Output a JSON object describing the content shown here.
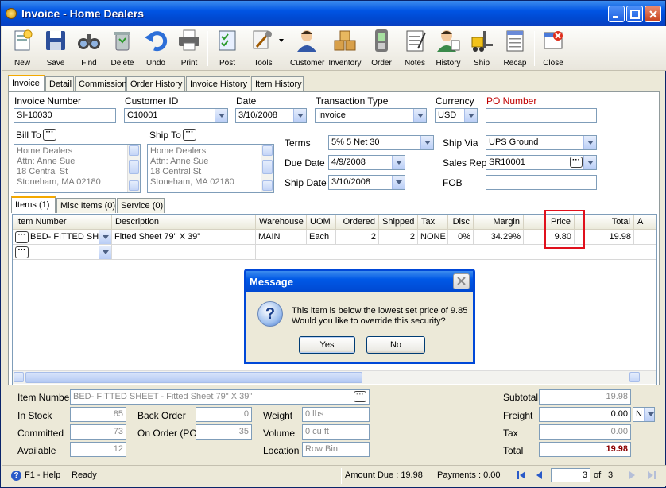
{
  "window": {
    "title": "Invoice - Home Dealers"
  },
  "toolbar": [
    {
      "label": "New",
      "icon": "new-document-icon"
    },
    {
      "label": "Save",
      "icon": "floppy-disk-icon"
    },
    {
      "label": "Find",
      "icon": "binoculars-icon"
    },
    {
      "label": "Delete",
      "icon": "trash-bin-icon"
    },
    {
      "label": "Undo",
      "icon": "undo-arrow-icon"
    },
    {
      "label": "Print",
      "icon": "printer-icon"
    },
    {
      "label": "Post",
      "icon": "post-checklist-icon"
    },
    {
      "label": "Tools",
      "icon": "tools-icon"
    },
    {
      "label": "Customer",
      "icon": "customer-person-icon"
    },
    {
      "label": "Inventory",
      "icon": "inventory-boxes-icon"
    },
    {
      "label": "Order",
      "icon": "order-device-icon"
    },
    {
      "label": "Notes",
      "icon": "notes-notepad-icon"
    },
    {
      "label": "History",
      "icon": "history-person-icon"
    },
    {
      "label": "Ship",
      "icon": "ship-forklift-icon"
    },
    {
      "label": "Recap",
      "icon": "recap-sheet-icon"
    },
    {
      "label": "Close",
      "icon": "close-window-icon"
    }
  ],
  "tabs": [
    "Invoice",
    "Detail",
    "Commission",
    "Order History",
    "Invoice History",
    "Item History"
  ],
  "header": {
    "invoice_number_label": "Invoice Number",
    "invoice_number": "SI-10030",
    "customer_id_label": "Customer ID",
    "customer_id": "C10001",
    "date_label": "Date",
    "date": "3/10/2008",
    "transaction_type_label": "Transaction Type",
    "transaction_type": "Invoice",
    "currency_label": "Currency",
    "currency": "USD",
    "po_number_label": "PO Number",
    "po_number": "",
    "bill_to_label": "Bill To",
    "ship_to_label": "Ship To",
    "bill_to": [
      "Home Dealers",
      "Attn: Anne Sue",
      "18 Central St",
      "Stoneham, MA 02180"
    ],
    "ship_to": [
      "Home Dealers",
      "Attn: Anne Sue",
      "18 Central St",
      "Stoneham, MA 02180"
    ],
    "terms_label": "Terms",
    "terms": "5% 5 Net 30",
    "due_date_label": "Due Date",
    "due_date": "4/9/2008",
    "ship_date_label": "Ship Date",
    "ship_date": "3/10/2008",
    "ship_via_label": "Ship Via",
    "ship_via": "UPS Ground",
    "sales_rep_label": "Sales Rep",
    "sales_rep": "SR10001",
    "fob_label": "FOB",
    "fob": ""
  },
  "subtabs": [
    "Items (1)",
    "Misc Items (0)",
    "Service (0)"
  ],
  "grid": {
    "columns": [
      "Item Number",
      "Description",
      "Warehouse",
      "UOM",
      "Ordered",
      "Shipped",
      "Tax",
      "Disc",
      "Margin",
      "Price",
      "Total",
      "A"
    ],
    "row": {
      "item_number": "BED- FITTED SHEE",
      "description": "Fitted Sheet 79\" X 39\"",
      "warehouse": "MAIN",
      "uom": "Each",
      "ordered": "2",
      "shipped": "2",
      "tax": "NONE",
      "disc": "0%",
      "margin": "34.29%",
      "price": "9.80",
      "total": "19.98"
    }
  },
  "dialog": {
    "title": "Message",
    "line1": "This item is below the lowest set price of 9.85",
    "line2": "Would you like to override this security?",
    "yes": "Yes",
    "no": "No"
  },
  "bottom": {
    "item_number_label": "Item Number",
    "item_number": "BED- FITTED SHEET - Fitted Sheet 79\" X 39\"",
    "in_stock_label": "In Stock",
    "in_stock": "85",
    "committed_label": "Committed",
    "committed": "73",
    "available_label": "Available",
    "available": "12",
    "back_order_label": "Back Order",
    "back_order": "0",
    "on_order_label": "On Order (PO)",
    "on_order": "35",
    "weight_label": "Weight",
    "weight": "0 lbs",
    "volume_label": "Volume",
    "volume": "0 cu ft",
    "location_label": "Location",
    "location": "Row  Bin",
    "subtotal_label": "Subtotal",
    "subtotal": "19.98",
    "freight_label": "Freight",
    "freight": "0.00",
    "freight_code": "N",
    "tax_label": "Tax",
    "tax": "0.00",
    "total_label": "Total",
    "total": "19.98"
  },
  "status": {
    "help": "F1 - Help",
    "state": "Ready",
    "amount_due": "Amount Due : 19.98",
    "payments": "Payments : 0.00",
    "record": "3",
    "of": "of",
    "record_total": "3"
  }
}
